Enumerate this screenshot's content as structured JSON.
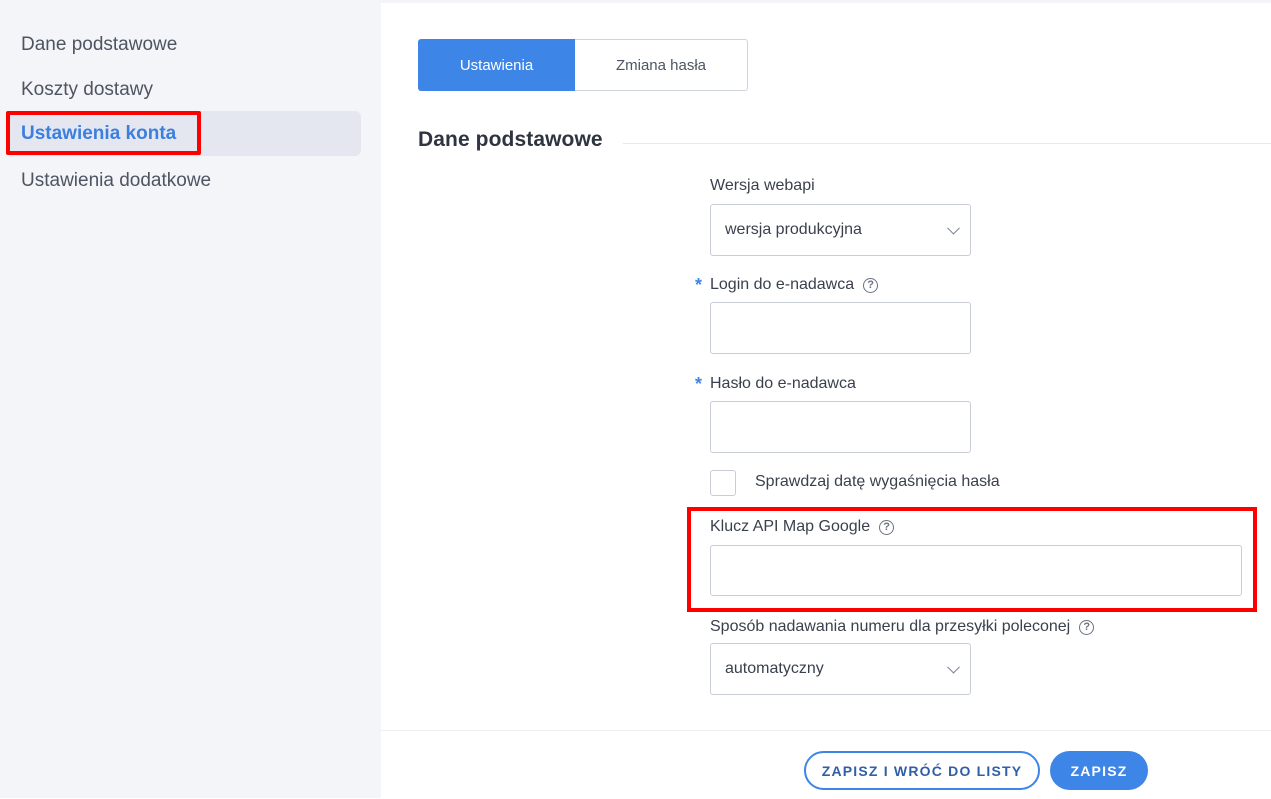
{
  "sidebar": {
    "items": [
      {
        "label": "Dane podstawowe"
      },
      {
        "label": "Koszty dostawy"
      },
      {
        "label": "Ustawienia konta"
      },
      {
        "label": "Ustawienia dodatkowe"
      }
    ]
  },
  "tabs": [
    {
      "label": "Ustawienia"
    },
    {
      "label": "Zmiana hasła"
    }
  ],
  "section": {
    "title": "Dane podstawowe"
  },
  "form": {
    "webapi_label": "Wersja webapi",
    "webapi_value": "wersja produkcyjna",
    "login_label": "Login do e-nadawca",
    "login_value": "",
    "password_label": "Hasło do e-nadawca",
    "password_value": "",
    "required_mark": "*",
    "help_glyph": "?",
    "checkbox_label": "Sprawdzaj datę wygaśnięcia hasła",
    "api_key_label": "Klucz API Map Google",
    "api_key_value": "",
    "numbering_label": "Sposób nadawania numeru dla przesyłki poleconej",
    "numbering_value": "automatyczny"
  },
  "footer": {
    "save_return_label": "ZAPISZ I WRÓĆ DO LISTY",
    "save_label": "ZAPISZ"
  },
  "colors": {
    "accent": "#3d85e6",
    "highlight": "#ff0000",
    "sidebar_bg": "#f4f5f8"
  }
}
